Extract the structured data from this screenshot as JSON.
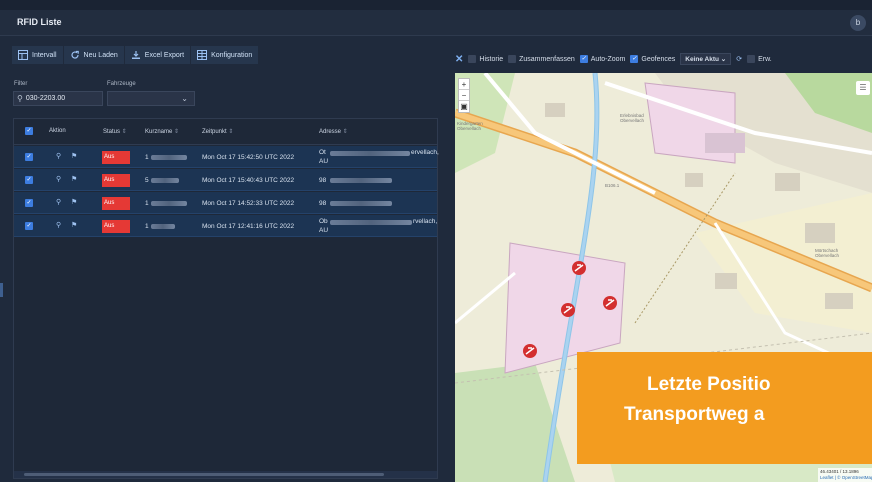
{
  "window": {
    "title": "RFID Liste",
    "user_initial": "b"
  },
  "toolbar": {
    "intervall": "Intervall",
    "neu_laden": "Neu Laden",
    "excel_export": "Excel Export",
    "konfiguration": "Konfiguration"
  },
  "filter": {
    "label": "Filter",
    "value": "030-2203.00",
    "fahrzeuge_label": "Fahrzeuge"
  },
  "grid": {
    "headers": {
      "aktion": "Aktion",
      "status": "Status",
      "kurzname": "Kurzname",
      "zeitpunkt": "Zeitpunkt",
      "adresse": "Adresse"
    },
    "rows": [
      {
        "status": "Aus",
        "kurzname": "1",
        "zeitpunkt": "Mon Oct 17 15:42:50 UTC 2022",
        "adresse": "Ot",
        "adresse_tail": "ervellach,",
        "adresse_line2": "AU"
      },
      {
        "status": "Aus",
        "kurzname": "5",
        "zeitpunkt": "Mon Oct 17 15:40:43 UTC 2022",
        "adresse": "98",
        "adresse_tail": "",
        "adresse_line2": ""
      },
      {
        "status": "Aus",
        "kurzname": "1",
        "zeitpunkt": "Mon Oct 17 14:52:33 UTC 2022",
        "adresse": "98",
        "adresse_tail": "",
        "adresse_line2": ""
      },
      {
        "status": "Aus",
        "kurzname": "1",
        "zeitpunkt": "Mon Oct 17 12:41:16 UTC 2022",
        "adresse": "Ob",
        "adresse_tail": "rvellach,",
        "adresse_line2": "AU"
      }
    ]
  },
  "map_toolbar": {
    "historie": "Historie",
    "zusammenfassen": "Zusammenfassen",
    "auto_zoom": "Auto-Zoom",
    "geofences": "Geofences",
    "select": "Keine Aktu",
    "erw": "Erw."
  },
  "map": {
    "labels": {
      "road": "B106.1",
      "place1": "Kindergarten Obervellach",
      "place2": "Erlebnisbad Obervellach",
      "place3": "Mörtschach Obervellach"
    },
    "attribution": {
      "coords": "46.43401 / 13.1896",
      "line2": "Leaflet | © OpenStreetMap"
    }
  },
  "banner": {
    "line1": "Letzte Positio",
    "line2": "Transportweg a"
  },
  "colors": {
    "accent": "#3d7de0",
    "status_off": "#e53935",
    "banner": "#f39c1f"
  }
}
